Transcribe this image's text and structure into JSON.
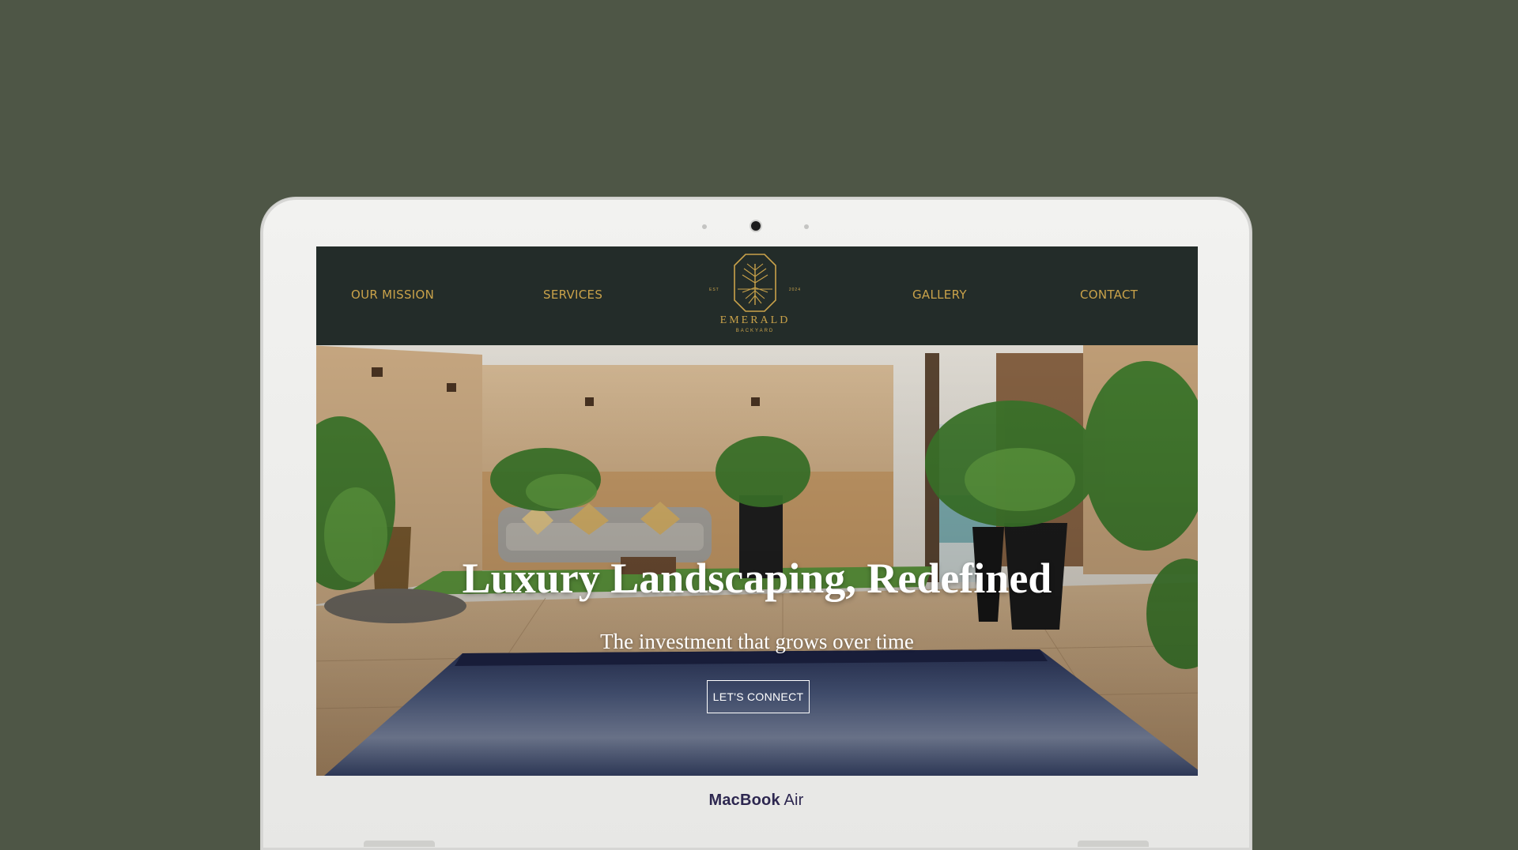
{
  "nav": {
    "left": [
      {
        "label": "OUR MISSION"
      },
      {
        "label": "SERVICES"
      }
    ],
    "right": [
      {
        "label": "GALLERY"
      },
      {
        "label": "CONTACT"
      }
    ]
  },
  "logo": {
    "name": "EMERALD",
    "subtitle": "BACKYARD",
    "est": "EST",
    "year": "2024"
  },
  "hero": {
    "title": "Luxury Landscaping, Redefined",
    "subtitle": "The investment that grows over time",
    "cta_label": "LET'S CONNECT"
  },
  "device": {
    "brand_bold": "MacBook",
    "brand_light": " Air"
  },
  "colors": {
    "background": "#4e5646",
    "header": "#232c29",
    "accent_gold": "#c9a24a"
  },
  "icons": {
    "logo": "tree-crest-icon"
  }
}
